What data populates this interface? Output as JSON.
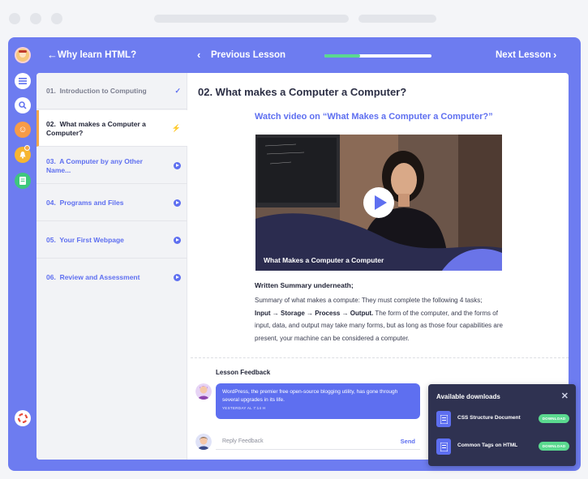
{
  "nav": {
    "back_label": "Why learn HTML?",
    "prev_label": "Previous Lesson",
    "next_label": "Next Lesson",
    "progress": 0.33
  },
  "lessons": [
    {
      "num": "01.",
      "title": "Introduction to Computing",
      "status": "completed"
    },
    {
      "num": "02.",
      "title": "What makes a Computer a Computer?",
      "status": "current"
    },
    {
      "num": "03.",
      "title": "A Computer by any Other Name...",
      "status": "play"
    },
    {
      "num": "04.",
      "title": "Programs and Files",
      "status": "play"
    },
    {
      "num": "05.",
      "title": "Your First Webpage",
      "status": "play"
    },
    {
      "num": "06.",
      "title": "Review and Assessment",
      "status": "play"
    }
  ],
  "main": {
    "title": "02. What makes a Computer a Computer?",
    "video_heading": "Watch video on “What Makes a Computer a Computer?”",
    "video_caption": "What Makes a Computer a Computer",
    "summary_heading": "Written Summary underneath;",
    "summary_intro": "Summary of what makes a compute: They must complete the following 4 tasks;",
    "summary_flow": "Input → Storage → Process → Output.",
    "summary_rest": " The form of the computer, and the forms of input, data, and output may take many forms, but as long as those four capabilities are present, your machine can be considered a computer."
  },
  "feedback": {
    "heading": "Lesson Feedback",
    "message": "WordPress, the premier free open-source blogging utility, has gone through several upgrades in its life.",
    "timestamp": "YESTERDAY AL 7:14 H",
    "reply_placeholder": "Reply Feedback",
    "send_label": "Send"
  },
  "downloads": {
    "title": "Available downloads",
    "close_symbol": "✕",
    "items": [
      {
        "name": "CSS Structure Document",
        "button": "DOWNLOAD"
      },
      {
        "name": "Common Tags on HTML",
        "button": "DOWNLOAD"
      }
    ]
  },
  "colors": {
    "accent": "#6d7cf0",
    "primary": "#5e6ff0",
    "success": "#5ad98f",
    "warning": "#f4a74a",
    "dark_card": "#2f3251"
  }
}
